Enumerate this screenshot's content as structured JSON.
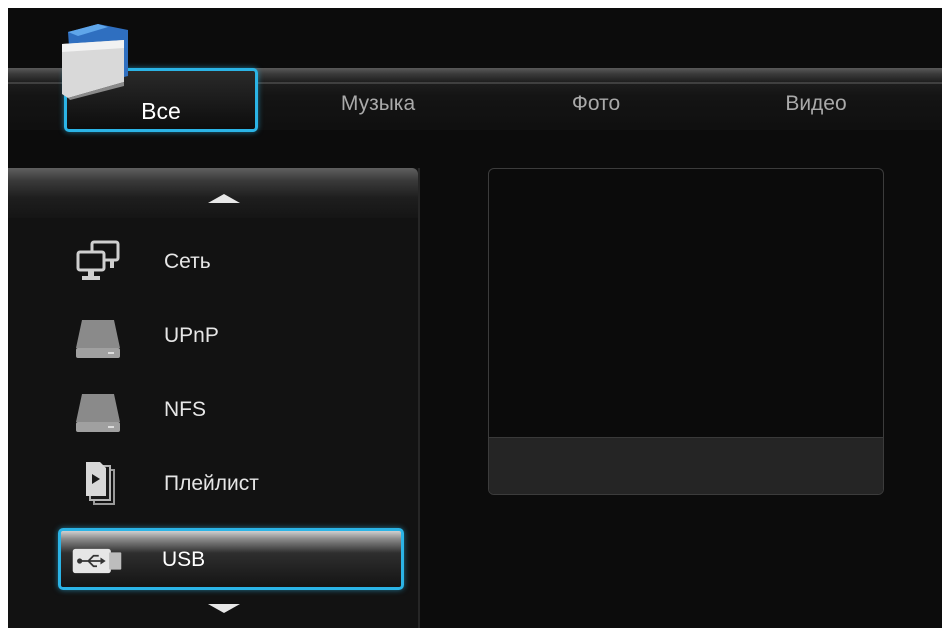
{
  "tabs": [
    {
      "label": "Все",
      "active": true
    },
    {
      "label": "Музыка",
      "active": false
    },
    {
      "label": "Фото",
      "active": false
    },
    {
      "label": "Видео",
      "active": false
    }
  ],
  "list": {
    "items": [
      {
        "label": "Сеть",
        "icon": "network-computers-icon"
      },
      {
        "label": "UPnP",
        "icon": "drive-icon"
      },
      {
        "label": "NFS",
        "icon": "drive-icon"
      },
      {
        "label": "Плейлист",
        "icon": "playlist-icon"
      },
      {
        "label": "USB",
        "icon": "usb-drive-icon",
        "selected": true
      }
    ],
    "scroll_up_icon": "arrow-up-icon",
    "scroll_down_icon": "arrow-down-icon"
  },
  "colors": {
    "accent": "#2bb4e6",
    "background": "#0c0c0c",
    "text": "#e6e6e6",
    "inactive_text": "#a9a9a9"
  }
}
